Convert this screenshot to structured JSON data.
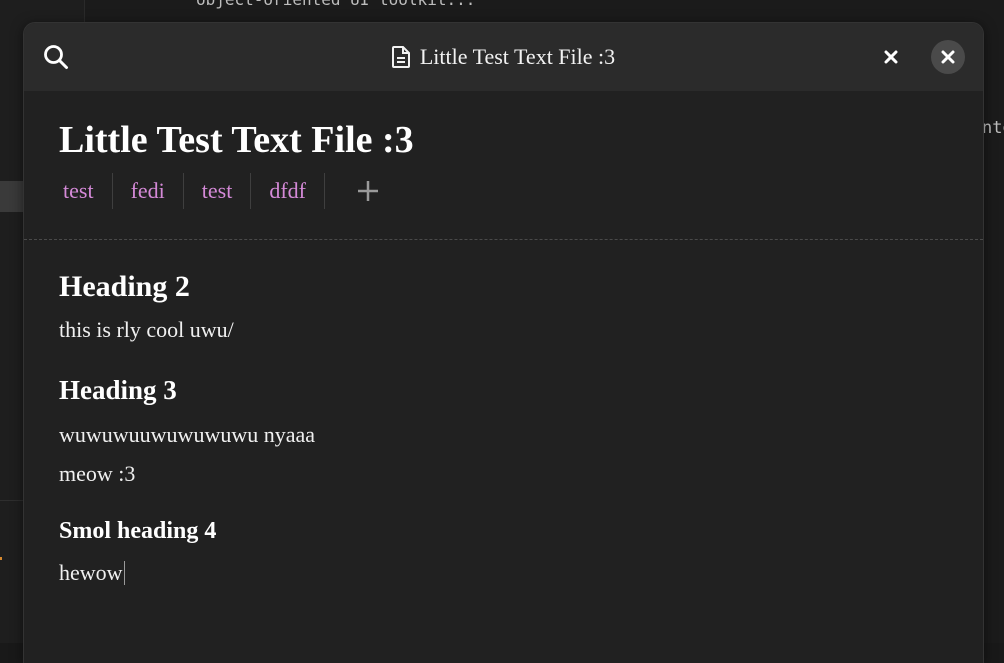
{
  "background": {
    "top_text": "object-oriented UI toolkit...",
    "right_text": "nte"
  },
  "header": {
    "title": "Little Test Text File :3",
    "icons": {
      "search": "search-icon",
      "document": "document-icon",
      "delete": "x-icon",
      "close": "close-icon"
    }
  },
  "note": {
    "title": "Little Test Text File :3",
    "tags": [
      "test",
      "fedi",
      "test",
      "dfdf"
    ],
    "add_tag_icon": "plus-icon",
    "accent_color": "#d58ad8"
  },
  "content": {
    "heading2": "Heading 2",
    "para1": "this is rly cool uwu/",
    "heading3": "Heading 3",
    "para2": "wuwuwuuwuwuwuwu nyaaa",
    "para3": "meow :3",
    "heading4": "Smol heading 4",
    "para4": "hewow"
  }
}
